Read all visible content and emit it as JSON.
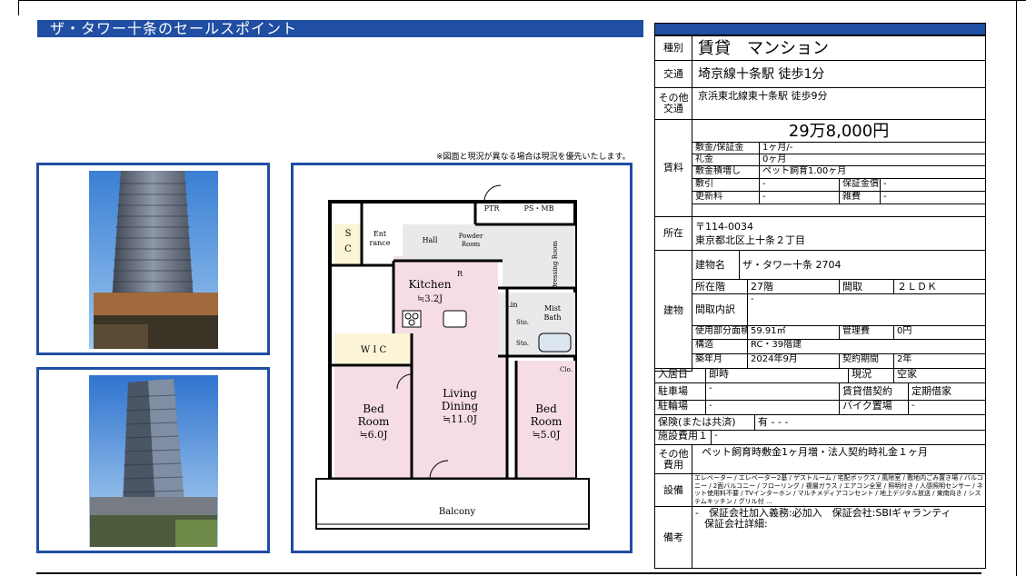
{
  "section_title": "ザ・タワー十条のセールスポイント",
  "plan_note": "※図面と現況が異なる場合は現況を優先いたします。",
  "floorplan": {
    "rooms": {
      "sic": "S\nI\nC",
      "entrance": "Ent\nrance",
      "hall": "Hall",
      "powder": "Powder\nRoom",
      "ptr": "PTR",
      "psmb": "PS・MB",
      "dressing": "Dressing\nRoom",
      "kitchen": "Kitchen",
      "kitchen_size": "≒3.2J",
      "lin": "Lin",
      "sto1": "Sto.",
      "sto2": "Sto.",
      "mist_bath": "Mist\nBath",
      "wic": "W I C",
      "clo": "Clo.",
      "bed1": "Bed\nRoom",
      "bed1_size": "≒6.0J",
      "living": "Living\nDining",
      "living_size": "≒11.0J",
      "bed2": "Bed\nRoom",
      "bed2_size": "≒5.0J",
      "balcony": "Balcony",
      "r": "R"
    }
  },
  "spec": {
    "type_label": "種別",
    "type_value": "賃貸　マンション",
    "transport_label": "交通",
    "transport_value": "埼京線十条駅 徒歩1分",
    "other_transport_label1": "その他",
    "other_transport_label2": "交通",
    "other_transport_value": "京浜東北線東十条駅 徒歩9分",
    "rent_label": "賃料",
    "rent_value": "29万8,000円",
    "deposit_label": "敷金/保証金",
    "deposit_value": "1ヶ月/-",
    "key_money_label": "礼金",
    "key_money_value": "0ヶ月",
    "deposit_add_label": "敷金積増し",
    "deposit_add_value": "ペット飼育1.00ヶ月",
    "deduction_label": "敷引",
    "deduction_value": "-",
    "guarantee_amort_label": "保証金償却",
    "guarantee_amort_value": "-",
    "renewal_label": "更新料",
    "renewal_value": "-",
    "misc_label": "雑費",
    "misc_value": "-",
    "address_label": "所在",
    "postal": "〒114-0034",
    "address": "東京都北区上十条２丁目",
    "building_label": "建物",
    "building_name_label": "建物名",
    "building_name_value": "ザ・タワー十条 2704",
    "floor_label": "所在階",
    "floor_value": "27階",
    "layout_label": "間取",
    "layout_value": "２ＬＤＫ",
    "layout_detail_label": "間取内訳",
    "layout_detail_value": "-",
    "area_label": "使用部分面積",
    "area_value": "59.91㎡",
    "mgmt_fee_label": "管理費",
    "mgmt_fee_value": "0円",
    "structure_label": "構造",
    "structure_value": "RC・39階建",
    "built_label": "築年月",
    "built_value": "2024年9月",
    "contract_period_label": "契約期間",
    "contract_period_value": "2年",
    "move_in_label": "入居日",
    "move_in_value": "即時",
    "status_label": "現況",
    "status_value": "空家",
    "parking_label": "駐車場",
    "parking_value": "-",
    "lease_type_label": "賃貸借契約",
    "lease_type_value": "定期借家",
    "bicycle_label": "駐輪場",
    "bicycle_value": "-",
    "bike_label": "バイク置場",
    "bike_value": "-",
    "insurance_label": "保険(または共済)",
    "insurance_value": "有 - - -",
    "facility_fee_label": "施設費用１",
    "facility_fee_value": "-",
    "other_cost_label1": "その他",
    "other_cost_label2": "費用",
    "other_cost_value": "ペット飼育時敷金1ヶ月増・法人契約時礼金１ヶ月",
    "equipment_label": "設備",
    "equipment_value": "エレベーター / エレベーター2基 / ゲストルーム / 宅配ボックス / 風除室 / 敷地内ごみ置き場 / バルコニー / 2面バルコニー / フローリング / 複層ガラス / エアコン全室 / 照明付き / 人感照明センサー / ネット使用料不要 / TVインターホン / マルチメディアコンセント / 地上デジタル放送 / 東南向き / システムキッチン / グリル付 …",
    "remarks_label": "備考",
    "remarks_line1": "-　保証会社加入義務:必加入　保証会社:SBIギャランティ",
    "remarks_line2": "保証会社詳細:"
  },
  "colors": {
    "accent": "#1f4ea3",
    "room_pink": "#f6dde4",
    "room_gray": "#e9e9ec",
    "wic_cream": "#fbf4d6"
  }
}
